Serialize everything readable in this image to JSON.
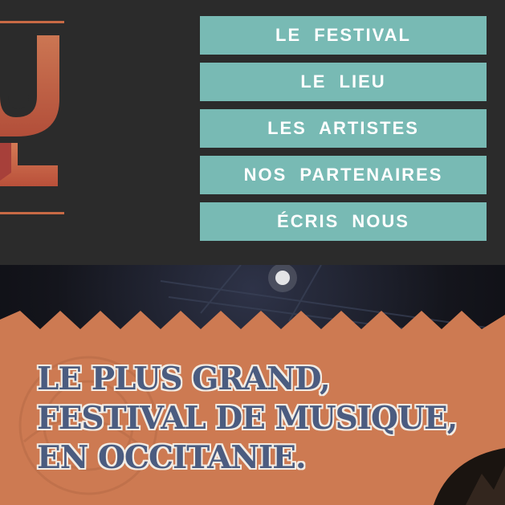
{
  "nav": {
    "items": [
      {
        "label": "LE FESTIVAL"
      },
      {
        "label": "LE LIEU"
      },
      {
        "label": "LES ARTISTES"
      },
      {
        "label": "NOS PARTENAIRES"
      },
      {
        "label": "ÉCRIS NOUS"
      }
    ]
  },
  "hero": {
    "headline_lines": [
      "LE PLUS GRAND,",
      "FESTIVAL DE MUSIQUE,",
      "EN OCCITANIE."
    ]
  },
  "colors": {
    "header_bg": "#2b2b2b",
    "nav_button": "#78bab4",
    "banner_orange": "#cd7a52",
    "headline_text": "#4b5c80",
    "logo_copper": "#c86a45"
  },
  "icons": {
    "logo": "festival-logo"
  }
}
